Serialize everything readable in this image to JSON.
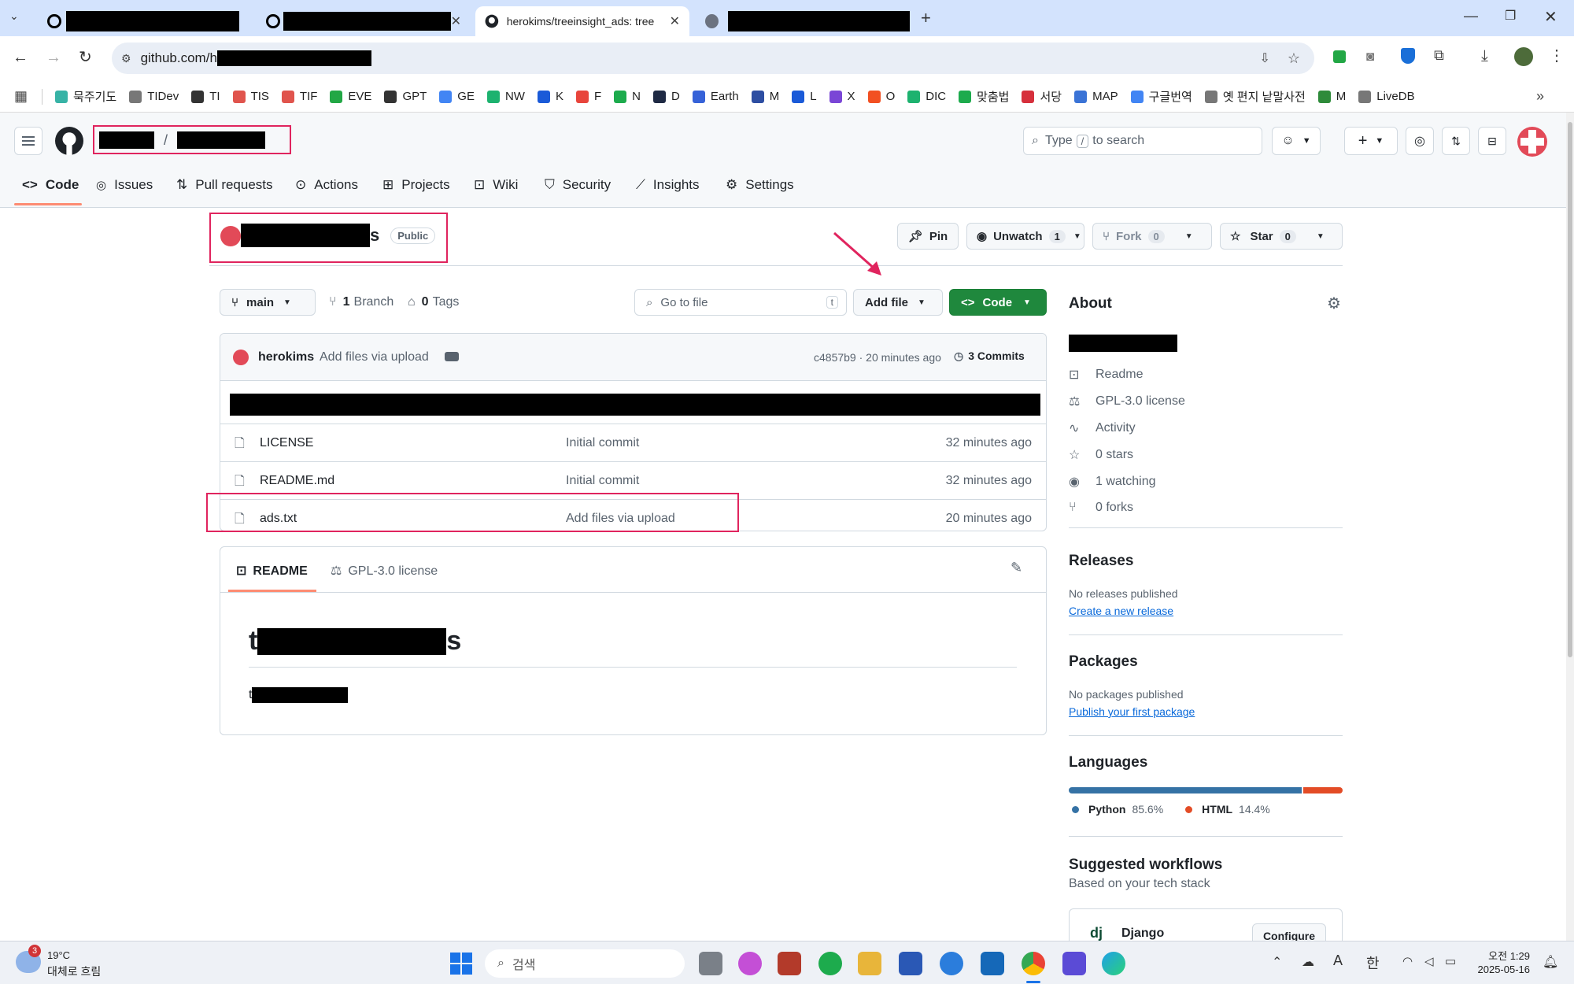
{
  "browser": {
    "tabs": [
      {
        "label": ""
      },
      {
        "label": ""
      },
      {
        "label": "herokims/treeinsight_ads: tree"
      },
      {
        "label": ""
      }
    ],
    "url": "github.com/h",
    "bookmarks": [
      "묵주기도",
      "TIDev",
      "TI",
      "TIS",
      "TIF",
      "EVE",
      "GPT",
      "GE",
      "NW",
      "K",
      "F",
      "N",
      "D",
      "Earth",
      "M",
      "L",
      "X",
      "O",
      "DIC",
      "맞춤법",
      "서당",
      "MAP",
      "구글번역",
      "옛 편지 낱말사전",
      "M",
      "LiveDB"
    ]
  },
  "header": {
    "breadcrumb_separator": "/",
    "search_placeholder_prefix": "Type",
    "search_key": "/",
    "search_placeholder_suffix": "to search"
  },
  "repo_nav": {
    "tabs": [
      "Code",
      "Issues",
      "Pull requests",
      "Actions",
      "Projects",
      "Wiki",
      "Security",
      "Insights",
      "Settings"
    ]
  },
  "repo": {
    "name_suffix": "s",
    "visibility": "Public",
    "pin_label": "Pin",
    "unwatch_label": "Unwatch",
    "unwatch_count": "1",
    "fork_label": "Fork",
    "fork_count": "0",
    "star_label": "Star",
    "star_count": "0"
  },
  "toolbar": {
    "branch": "main",
    "branches_count": "1",
    "branches_label": "Branch",
    "tags_count": "0",
    "tags_label": "Tags",
    "goto_placeholder": "Go to file",
    "goto_key": "t",
    "add_file_label": "Add file",
    "code_label": "Code"
  },
  "commit_bar": {
    "author": "herokims",
    "message": "Add files via upload",
    "hash": "c4857b9",
    "dot": "·",
    "time": "20 minutes ago",
    "commits_label": "3 Commits"
  },
  "files": [
    {
      "name": "LICENSE",
      "message": "Initial commit",
      "time": "32 minutes ago"
    },
    {
      "name": "README.md",
      "message": "Initial commit",
      "time": "32 minutes ago"
    },
    {
      "name": "ads.txt",
      "message": "Add files via upload",
      "time": "20 minutes ago"
    }
  ],
  "readme": {
    "tab_readme": "README",
    "tab_license": "GPL-3.0 license",
    "heading_prefix": "t",
    "heading_suffix": "s",
    "body_prefix": "t"
  },
  "about": {
    "title": "About",
    "items": [
      "Readme",
      "GPL-3.0 license",
      "Activity",
      "0 stars",
      "1 watching",
      "0 forks"
    ]
  },
  "releases": {
    "title": "Releases",
    "empty_text": "No releases published",
    "link": "Create a new release"
  },
  "packages": {
    "title": "Packages",
    "empty_text": "No packages published",
    "link": "Publish your first package"
  },
  "languages": {
    "title": "Languages",
    "items": [
      {
        "name": "Python",
        "percent": "85.6%",
        "value": 85.6,
        "color": "#3572A5"
      },
      {
        "name": "HTML",
        "percent": "14.4%",
        "value": 14.4,
        "color": "#e34c26"
      }
    ]
  },
  "workflows": {
    "title": "Suggested workflows",
    "subtitle": "Based on your tech stack",
    "item_name": "Django",
    "item_button": "Configure"
  },
  "taskbar": {
    "weather_badge": "3",
    "temperature": "19°C",
    "weather_text": "대체로 흐림",
    "search_placeholder": "검색",
    "ime_letter": "A",
    "ime_lang": "한",
    "time": "오전 1:29",
    "date": "2025-05-16"
  },
  "colors": {
    "highlight": "#e0245e",
    "code_button": "#1f883d",
    "link": "#0969da"
  }
}
